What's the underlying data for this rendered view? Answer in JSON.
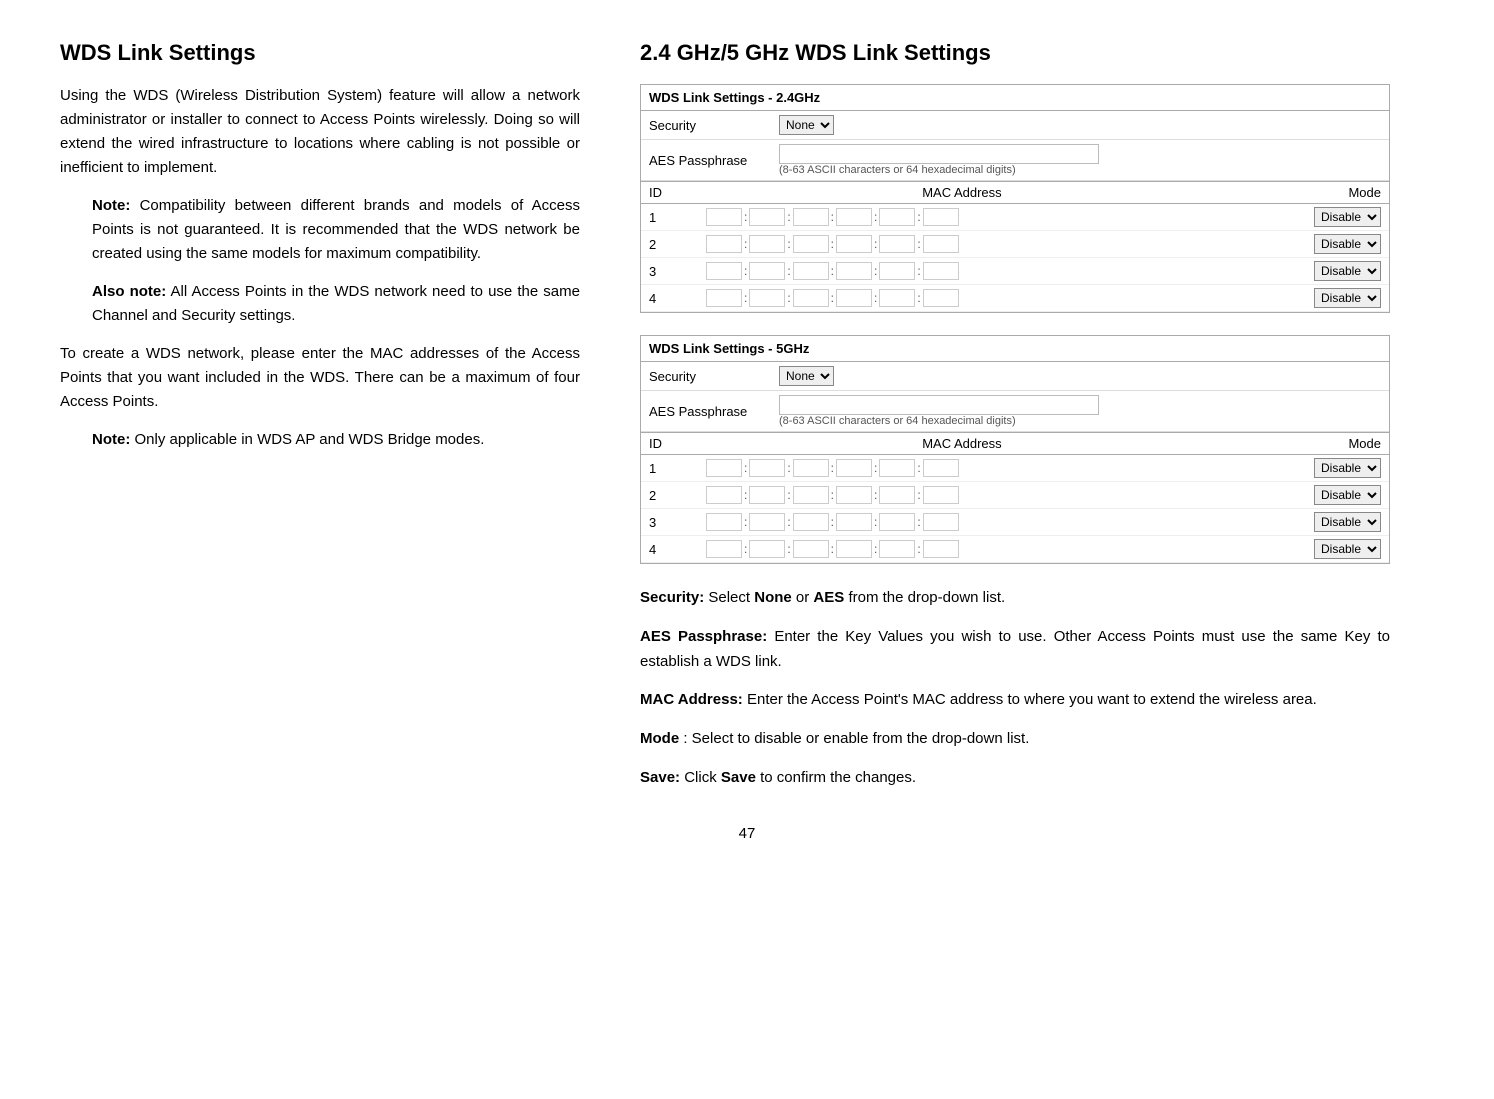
{
  "left": {
    "heading": "WDS Link Settings",
    "intro": "Using the WDS (Wireless Distribution System) feature will allow a network administrator or installer to connect to Access Points wirelessly. Doing so will extend the wired infrastructure to locations where cabling is not possible or inefficient to implement.",
    "note1_label": "Note:",
    "note1_text": " Compatibility between different brands and models of Access Points is not guaranteed. It is recommended that the WDS network be created using the same models for maximum compatibility.",
    "note2_label": "Also note:",
    "note2_text": " All Access Points in the WDS network need to use the same Channel and Security settings.",
    "para2": "To create a WDS network, please enter the MAC addresses of the Access Points that you want included in the WDS. There can be a maximum of four Access Points.",
    "note3_label": "Note:",
    "note3_text": " Only applicable in WDS AP and WDS Bridge modes."
  },
  "right": {
    "heading": "2.4 GHz/5 GHz WDS Link Settings",
    "table24_title": "WDS Link Settings - 2.4GHz",
    "table5_title": "WDS Link Settings - 5GHz",
    "security_label": "Security",
    "security_options": [
      "None",
      "AES"
    ],
    "security_default": "None",
    "aes_label": "AES Passphrase",
    "aes_hint": "(8-63 ASCII characters or 64 hexadecimal digits)",
    "col_id": "ID",
    "col_mac": "MAC Address",
    "col_mode": "Mode",
    "rows": [
      {
        "id": "1",
        "mode_default": "Disable"
      },
      {
        "id": "2",
        "mode_default": "Disable"
      },
      {
        "id": "3",
        "mode_default": "Disable"
      },
      {
        "id": "4",
        "mode_default": "Disable"
      }
    ],
    "mode_options": [
      "Disable",
      "Enable"
    ],
    "desc_security_label": "Security:",
    "desc_security_text": " Select ",
    "desc_security_none": "None",
    "desc_security_or": " or ",
    "desc_security_aes": "AES",
    "desc_security_end": " from the drop-down list.",
    "desc_aes_label": "AES Passphrase:",
    "desc_aes_text": " Enter the Key Values you wish to use. Other Access Points must use the same Key to establish a WDS link.",
    "desc_mac_label": "MAC Address:",
    "desc_mac_text": " Enter the Access Point's MAC address to where you want to extend the wireless area.",
    "desc_mode_label": "Mode",
    "desc_mode_text": ": Select to disable or enable from the drop-down list.",
    "desc_save_label": "Save:",
    "desc_save_bold": "Save",
    "desc_save_text": " to confirm the changes.",
    "desc_save_click": " Click "
  },
  "page_number": "47"
}
